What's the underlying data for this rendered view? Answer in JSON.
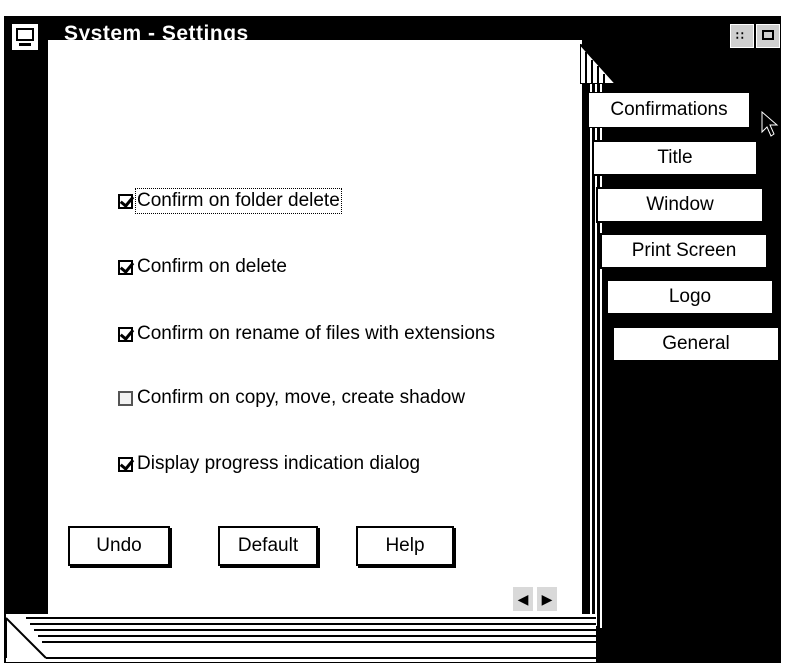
{
  "window": {
    "title": "System - Settings"
  },
  "tabs": [
    {
      "label": "Confirmations",
      "active": true
    },
    {
      "label": "Title",
      "active": false
    },
    {
      "label": "Window",
      "active": false
    },
    {
      "label": "Print Screen",
      "active": false
    },
    {
      "label": "Logo",
      "active": false
    },
    {
      "label": "General",
      "active": false
    }
  ],
  "options": [
    {
      "label": "Confirm on folder delete",
      "checked": true,
      "focused": true
    },
    {
      "label": "Confirm on delete",
      "checked": true,
      "focused": false
    },
    {
      "label": "Confirm on rename of files with extensions",
      "checked": true,
      "focused": false
    },
    {
      "label": "Confirm on copy, move, create shadow",
      "checked": false,
      "focused": false
    },
    {
      "label": "Display progress indication dialog",
      "checked": true,
      "focused": false
    }
  ],
  "buttons": {
    "undo": "Undo",
    "default": "Default",
    "help": "Help"
  },
  "page_arrows": {
    "back": "back-arrow-icon",
    "forward": "forward-arrow-icon"
  }
}
